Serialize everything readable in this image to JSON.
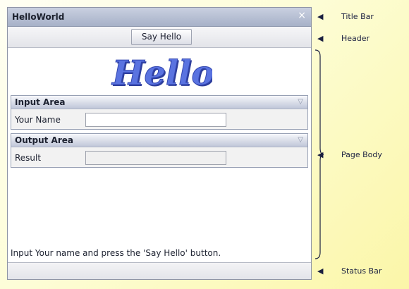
{
  "window": {
    "title": "HelloWorld",
    "close_glyph": "×"
  },
  "header": {
    "button_label": "Say Hello"
  },
  "logo_text": "Hello",
  "input_area": {
    "title": "Input Area",
    "field_label": "Your Name",
    "field_value": "",
    "toggle_glyph": "▽"
  },
  "output_area": {
    "title": "Output Area",
    "field_label": "Result",
    "field_value": "",
    "toggle_glyph": "▽"
  },
  "hint": "Input Your name and press the 'Say Hello' button.",
  "callouts": {
    "title_bar": "Title Bar",
    "header": "Header",
    "page_body": "Page Body",
    "status_bar": "Status Bar",
    "arrow": "◀"
  },
  "colors": {
    "frame_border": "#8f95a6",
    "title_gradient_top": "#c9d0e0",
    "logo_fill": "#4a63d6"
  }
}
